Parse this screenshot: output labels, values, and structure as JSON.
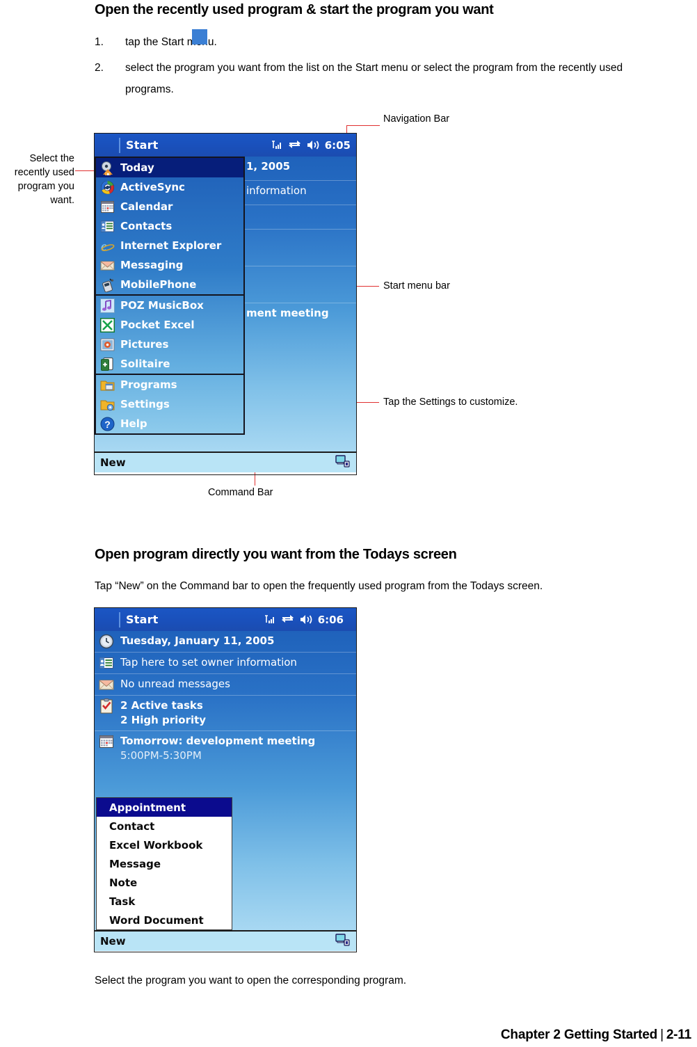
{
  "document": {
    "heading_1": "Open the recently used program & start the program you want",
    "steps": [
      {
        "number": "1.",
        "text": "tap the Start          menu."
      },
      {
        "number": "2.",
        "text": "select the program you want from the list on the Start menu or select the program from the recently used",
        "text_line2": "programs."
      }
    ],
    "heading_2": "Open program directly you want from the Todays screen",
    "paragraph_tap_new": "Tap “New” on the Command bar to open the frequently used program from the Todays screen.",
    "paragraph_select_open": "Select the program you want to open the corresponding program.",
    "footer": {
      "chapter": "Chapter 2 Getting Started",
      "separator": "|",
      "page": "2-11"
    }
  },
  "callouts": {
    "select_recent": "Select the\nrecently used\nprogram you\nwant.",
    "select_recent_lines": [
      "Select the",
      "recently used",
      "program you",
      "want."
    ],
    "navigation_bar": "Navigation Bar",
    "start_menu_bar": "Start menu bar",
    "tap_settings": "Tap the Settings to customize.",
    "command_bar": "Command Bar"
  },
  "colors": {
    "annotation_line": "#e03030",
    "annotation_dot": "#e8312a",
    "navbar_blue": "#1b50bb",
    "start_menu_selected": "#061e7a",
    "command_bar": "#b9e4f6",
    "new_menu_selected": "#0b0b8e"
  },
  "pda_screen_1": {
    "navbar": {
      "start_label": "Start",
      "clock": "6:05",
      "icons": [
        "signal-icon",
        "connectivity-icon",
        "volume-icon"
      ]
    },
    "start_menu": {
      "groups": [
        [
          {
            "label": "Today",
            "icon": "today-home-icon",
            "selected": true
          },
          {
            "label": "ActiveSync",
            "icon": "activesync-icon",
            "selected": false
          },
          {
            "label": "Calendar",
            "icon": "calendar-icon",
            "selected": false
          },
          {
            "label": "Contacts",
            "icon": "contacts-icon",
            "selected": false
          },
          {
            "label": "Internet Explorer",
            "icon": "internet-explorer-icon",
            "selected": false
          },
          {
            "label": "Messaging",
            "icon": "messaging-icon",
            "selected": false
          },
          {
            "label": "MobilePhone",
            "icon": "mobilephone-icon",
            "selected": false
          }
        ],
        [
          {
            "label": "POZ MusicBox",
            "icon": "music-note-icon",
            "selected": false
          },
          {
            "label": "Pocket Excel",
            "icon": "excel-icon",
            "selected": false
          },
          {
            "label": "Pictures",
            "icon": "pictures-icon",
            "selected": false
          },
          {
            "label": "Solitaire",
            "icon": "solitaire-icon",
            "selected": false
          }
        ],
        [
          {
            "label": "Programs",
            "icon": "programs-folder-icon",
            "selected": false
          },
          {
            "label": "Settings",
            "icon": "settings-folder-icon",
            "selected": false
          },
          {
            "label": "Help",
            "icon": "help-question-icon",
            "selected": false
          }
        ]
      ]
    },
    "today_background_rows": [
      {
        "text": "1, 2005",
        "bold": true
      },
      {
        "text": "information",
        "bold": false
      },
      {
        "text": "",
        "bold": false
      },
      {
        "text": "",
        "bold": false
      },
      {
        "text": "",
        "bold": false
      },
      {
        "text": "ment meeting",
        "bold": true
      }
    ],
    "command_bar": {
      "new_label": "New",
      "right_icon": "keyboard-input-icon"
    }
  },
  "pda_screen_2": {
    "navbar": {
      "start_label": "Start",
      "clock": "6:06",
      "icons": [
        "signal-icon",
        "connectivity-icon",
        "volume-icon"
      ]
    },
    "today_rows": [
      {
        "icon": "clock-icon",
        "label": "Tuesday, January 11, 2005",
        "bold": true
      },
      {
        "icon": "owner-info-icon",
        "label": "Tap here to set owner information",
        "bold": false
      },
      {
        "icon": "messaging-icon",
        "label": "No unread messages",
        "bold": false
      },
      {
        "icon": "tasks-icon",
        "label": "2 Active tasks",
        "label2": "2 High priority",
        "bold": true
      },
      {
        "icon": "calendar-icon",
        "label": "Tomorrow: development meeting",
        "label2": "5:00PM-5:30PM",
        "bold": true
      }
    ],
    "new_menu": {
      "items": [
        {
          "label": "Appointment",
          "selected": true
        },
        {
          "label": "Contact",
          "selected": false
        },
        {
          "label": "Excel Workbook",
          "selected": false
        },
        {
          "label": "Message",
          "selected": false
        },
        {
          "label": "Note",
          "selected": false
        },
        {
          "label": "Task",
          "selected": false
        },
        {
          "label": "Word Document",
          "selected": false
        }
      ]
    },
    "command_bar": {
      "new_label": "New",
      "right_icon": "keyboard-input-icon"
    }
  }
}
